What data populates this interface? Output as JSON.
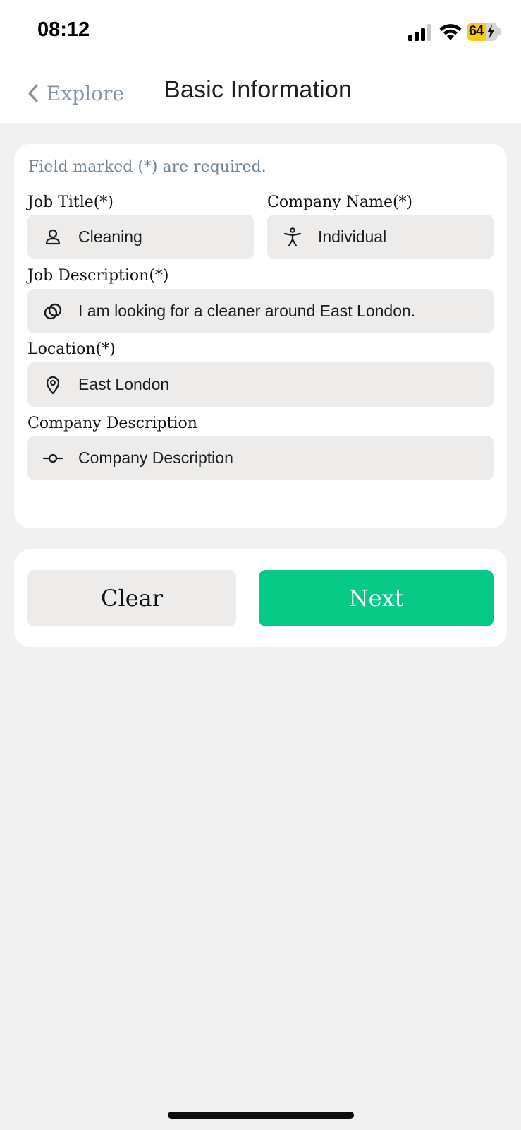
{
  "status_bar": {
    "time": "08:12",
    "battery_percent": "64",
    "battery_level": 0.64,
    "charging": true,
    "icons": [
      "signal-icon",
      "wifi-icon",
      "battery-icon"
    ]
  },
  "nav": {
    "back_label": "Explore",
    "title": "Basic Information"
  },
  "form": {
    "hint": "Field marked (*) are required.",
    "job_title": {
      "label": "Job Title(*)",
      "value": "Cleaning",
      "icon": "person-icon"
    },
    "company_name": {
      "label": "Company Name(*)",
      "value": "Individual",
      "icon": "accessibility-icon"
    },
    "job_description": {
      "label": "Job Description(*)",
      "value": "I am looking for a cleaner around East London.",
      "icon": "rings-icon"
    },
    "location": {
      "label": "Location(*)",
      "value": "East London",
      "icon": "location-pin-icon"
    },
    "company_description": {
      "label": "Company Description",
      "placeholder": "Company Description",
      "icon": "commit-icon"
    }
  },
  "actions": {
    "clear_label": "Clear",
    "next_label": "Next"
  },
  "colors": {
    "accent": "#06c986",
    "field_bg": "#edecea",
    "page_bg": "#f1f1f1",
    "hint_text": "#738492",
    "battery": "#f6cc15"
  }
}
